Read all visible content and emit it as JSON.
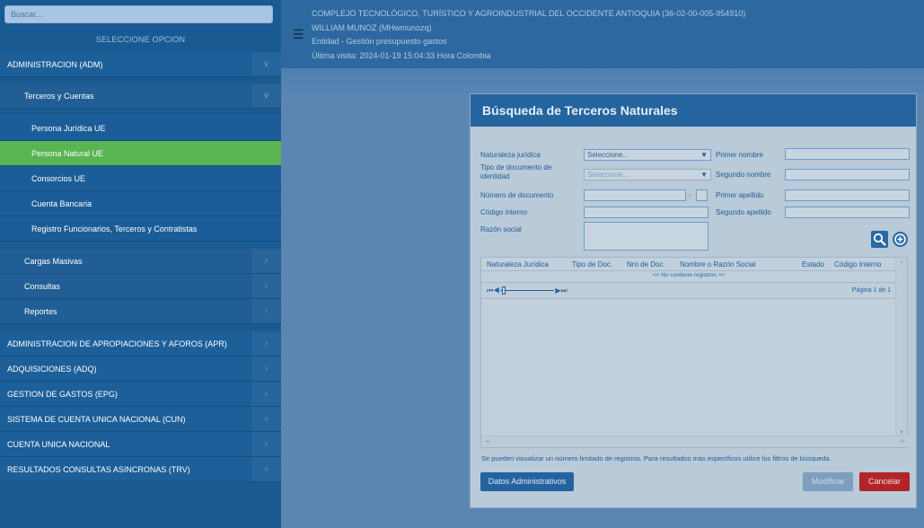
{
  "search": {
    "placeholder": "Buscar..."
  },
  "sidebar": {
    "select_title": "SELECCIONE OPCION",
    "items": [
      {
        "label": "ADMINISTRACION (ADM)"
      },
      {
        "label": "Terceros y Cuentas"
      },
      {
        "label": "Persona Jurídica UE"
      },
      {
        "label": "Persona Natural UE"
      },
      {
        "label": "Consorcios UE"
      },
      {
        "label": "Cuenta Bancaria"
      },
      {
        "label": "Registro Funcionarios, Terceros y Contratistas"
      },
      {
        "label": "Cargas Masivas"
      },
      {
        "label": "Consultas"
      },
      {
        "label": "Reportes"
      },
      {
        "label": "ADMINISTRACION DE APROPIACIONES Y AFOROS (APR)"
      },
      {
        "label": "ADQUISICIONES (ADQ)"
      },
      {
        "label": "GESTION DE GASTOS (EPG)"
      },
      {
        "label": "SISTEMA DE CUENTA UNICA NACIONAL (CUN)"
      },
      {
        "label": "CUENTA UNICA NACIONAL"
      },
      {
        "label": "RESULTADOS CONSULTAS ASINCRONAS (TRV)"
      }
    ]
  },
  "header": {
    "entity": "COMPLEJO TECNOLÓGICO, TURÍSTICO Y AGROINDUSTRIAL DEL OCCIDENTE ANTIOQUIA (36-02-00-005-954910)",
    "user": "WILLIAM MUNOZ (MHwmunozq)",
    "module": "Entidad - Gestión presupuesto gastos",
    "last_visit": "Última visita: 2024-01-19 15:04:33 Hora Colombia"
  },
  "dialog": {
    "title": "Búsqueda de Terceros Naturales",
    "form": {
      "naturaleza_label": "Naturaleza jurídica",
      "naturaleza_value": "Seleccione...",
      "tipo_doc_label": "Tipo de documento de identidad",
      "tipo_doc_value": "Seleccione...",
      "numero_doc_label": "Número de documento",
      "numero_doc_separator": "-",
      "codigo_label": "Código interno",
      "razon_label": "Razón social",
      "primer_nombre_label": "Primer nombre",
      "segundo_nombre_label": "Segundo nombre",
      "primer_apellido_label": "Primer apellido",
      "segundo_apellido_label": "Segundo apellido"
    },
    "grid": {
      "columns": [
        "Naturaleza Jurídica",
        "Tipo de Doc.",
        "Nro de Doc.",
        "Nombre o Razón Social",
        "Estado",
        "Código Interno"
      ],
      "empty_message": "<< No contiene registros >>",
      "page_info": "Página 1 de 1"
    },
    "note": "Se pueden visualizar un número limitado de registros. Para resultados más específicos utilice los filtros de búsqueda.",
    "buttons": {
      "datos": "Datos Administrativos",
      "modificar": "Modificar",
      "cancelar": "Cancelar"
    }
  },
  "colors": {
    "sidebar_bg": "#195a92",
    "active_item": "#58b552",
    "dialog_title_bg": "#24649f",
    "cancel_button": "#b2242a"
  }
}
